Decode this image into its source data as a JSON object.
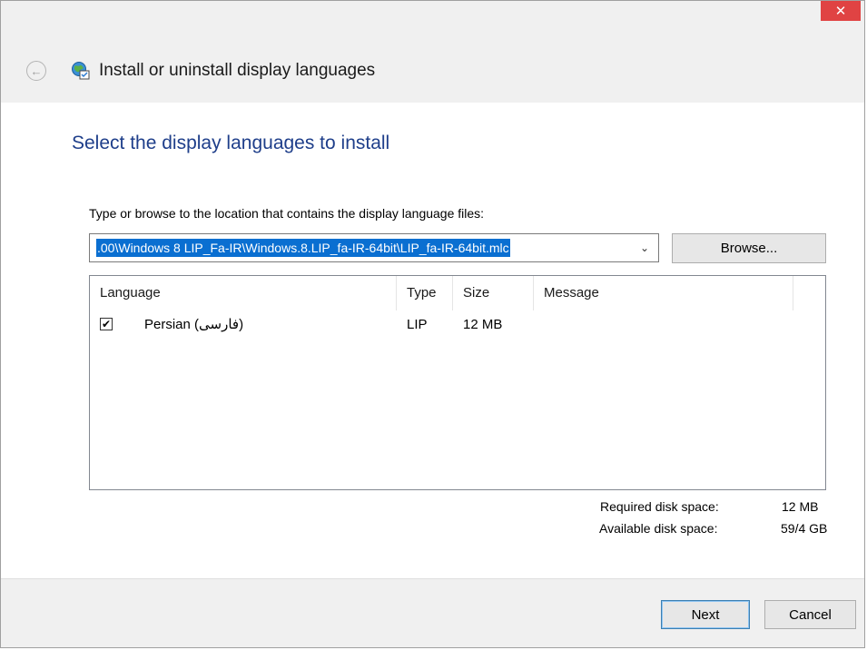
{
  "window": {
    "title": "Install or uninstall display languages",
    "close_glyph": "✕",
    "back_glyph": "←",
    "close_color": "#e04343"
  },
  "main": {
    "heading": "Select the display languages to install",
    "instruction": "Type or browse to the location that contains the display language files:",
    "path_value": ".00\\Windows 8 LIP_Fa-IR\\Windows.8.LIP_fa-IR-64bit\\LIP_fa-IR-64bit.mlc",
    "combo_arrow_glyph": "⌄",
    "browse_label": "Browse...",
    "list": {
      "columns": [
        "Language",
        "Type",
        "Size",
        "Message"
      ],
      "rows": [
        {
          "checked": true,
          "check_glyph": "✔",
          "language": "Persian (فارسی)",
          "type": "LIP",
          "size": "12 MB",
          "message": ""
        }
      ]
    },
    "disk": {
      "required_label": "Required disk space:",
      "required_value": "12 MB",
      "available_label": "Available disk space:",
      "available_value": "59/4 GB"
    }
  },
  "footer": {
    "next_label": "Next",
    "cancel_label": "Cancel"
  },
  "colors": {
    "heading": "#1e3e8a",
    "selection": "#0a6fd1",
    "chrome_bg": "#f0f0f0"
  }
}
